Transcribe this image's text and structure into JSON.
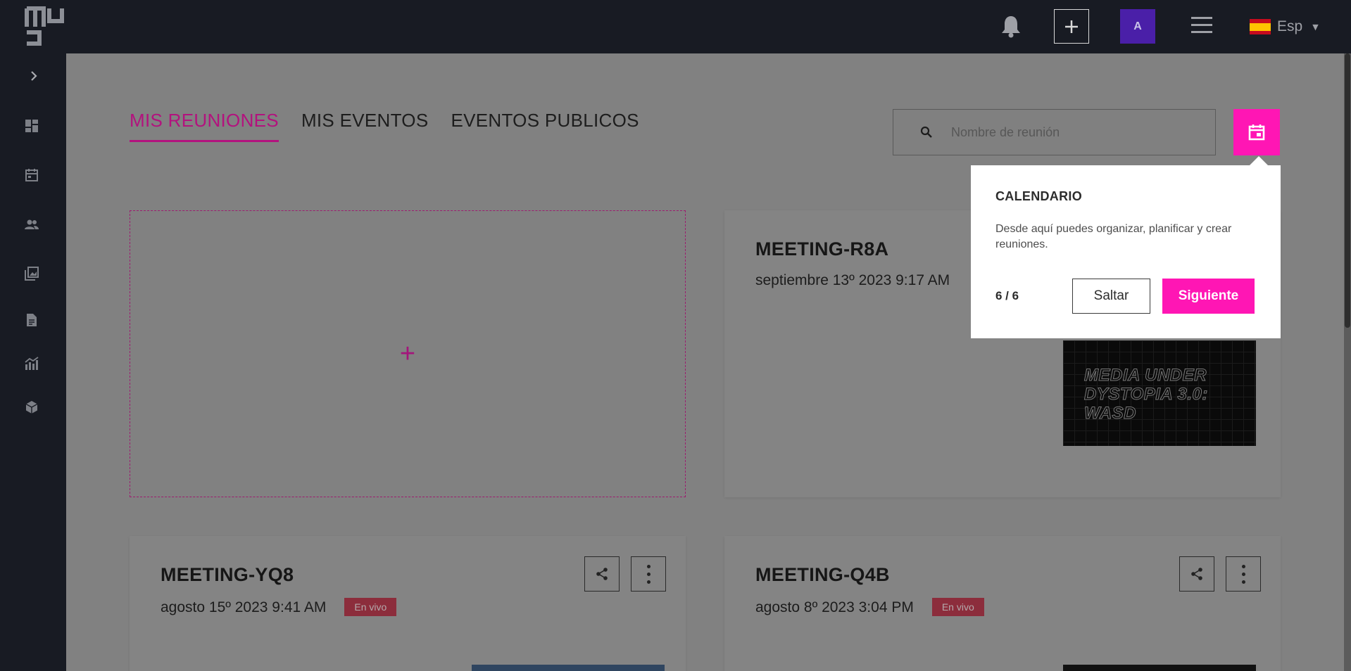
{
  "topbar": {
    "logo_icon": "mumu-logo-icon",
    "language_label": "Esp",
    "avatar_initial": "A"
  },
  "tabs": [
    {
      "label": "MIS REUNIONES",
      "active": true
    },
    {
      "label": "MIS EVENTOS",
      "active": false
    },
    {
      "label": "EVENTOS PUBLICOS",
      "active": false
    }
  ],
  "search": {
    "placeholder": "Nombre de reunión",
    "value": ""
  },
  "new_meeting": {
    "label": "+"
  },
  "meetings": [
    {
      "title": "MEETING-R8A",
      "date": "septiembre 13º 2023 9:17 AM",
      "badge": "",
      "thumbnail_text": "MEDIA UNDER DYSTOPIA 3.0: WASD"
    },
    {
      "title": "MEETING-YQ8",
      "date": "agosto 15º 2023 9:41 AM",
      "badge": "En vivo"
    },
    {
      "title": "MEETING-Q4B",
      "date": "agosto 8º 2023 3:04 PM",
      "badge": "En vivo"
    }
  ],
  "popover": {
    "title": "CALENDARIO",
    "body": "Desde aquí puedes organizar, planificar y crear reuniones.",
    "step": "6 / 6",
    "skip_label": "Saltar",
    "next_label": "Siguiente"
  },
  "colors": {
    "accent": "#ff16b4",
    "topbar": "#181b23",
    "avatar": "#4a1fa8"
  }
}
